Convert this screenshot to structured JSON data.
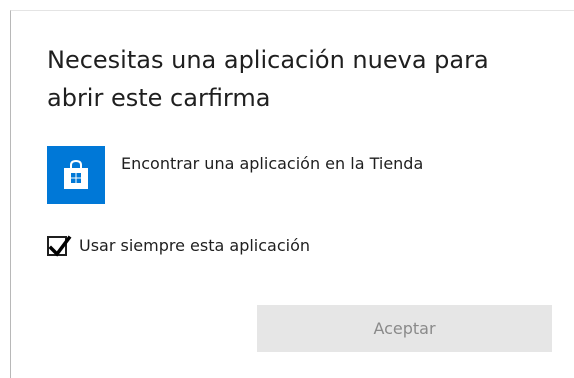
{
  "dialog": {
    "title": "Necesitas una aplicación nueva para abrir este carfirma",
    "store_option": {
      "label": "Encontrar una aplicación en la Tienda",
      "icon": "store-bag-icon",
      "tile_color": "#0078d7"
    },
    "always_use": {
      "label": "Usar siempre esta aplicación",
      "checked": true
    },
    "accept_button": {
      "label": "Aceptar",
      "enabled": false
    }
  }
}
